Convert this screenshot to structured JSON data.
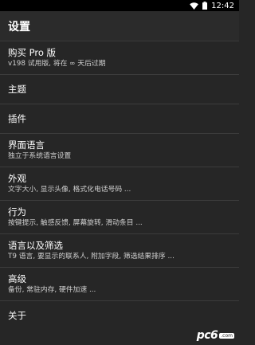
{
  "statusbar": {
    "time": "12:42",
    "icons": [
      "wifi-icon",
      "battery-icon"
    ]
  },
  "toolbar": {
    "title": "设置"
  },
  "items": [
    {
      "title": "购买 Pro 版",
      "subtitle": "v198 试用版, 将在 ∞ 天后过期"
    },
    {
      "title": "主题",
      "subtitle": ""
    },
    {
      "title": "插件",
      "subtitle": ""
    },
    {
      "title": "界面语言",
      "subtitle": "独立于系统语言设置"
    },
    {
      "title": "外观",
      "subtitle": "文字大小, 显示头像, 格式化电话号码 ..."
    },
    {
      "title": "行为",
      "subtitle": "按键提示, 触感反馈, 屏幕旋转, 滑动条目 ..."
    },
    {
      "title": "语言以及筛选",
      "subtitle": "T9 语言, 要显示的联系人, 附加字段, 筛选结果排序 ..."
    },
    {
      "title": "高级",
      "subtitle": "备份, 常驻内存, 硬件加速 ..."
    },
    {
      "title": "关于",
      "subtitle": ""
    }
  ],
  "watermark": {
    "text_pc": "pc",
    "text_six": "6",
    "text_com": ".com"
  },
  "colors": {
    "background": "#262626",
    "toolbar": "#2b2b2b",
    "statusbar": "#000000",
    "divider": "#3c3c3c"
  }
}
